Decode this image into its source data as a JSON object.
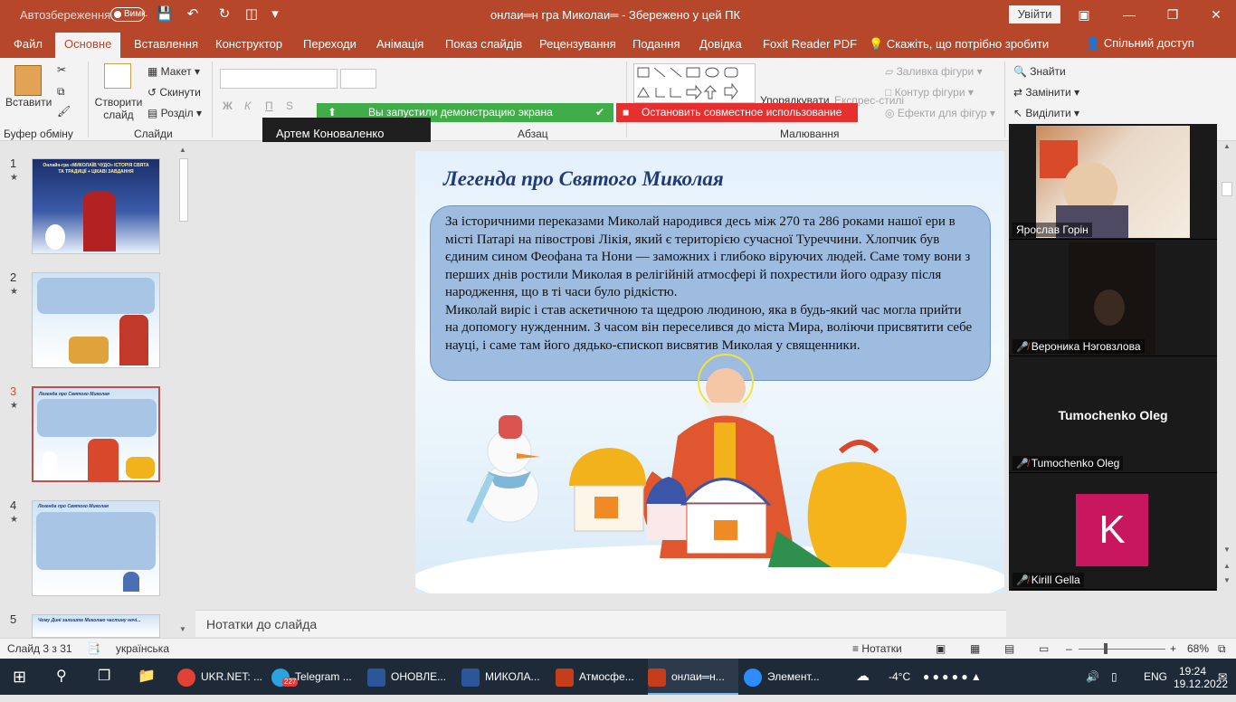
{
  "titlebar": {
    "autosave_label": "Автозбереження",
    "autosave_state": "Вимк.",
    "doc_title": "онлаи═н гра Миколаи═  -  Збережено у цей ПК",
    "sign_in": "Увійти"
  },
  "tabs": [
    "Файл",
    "Основне",
    "Вставлення",
    "Конструктор",
    "Переходи",
    "Анімація",
    "Показ слайдів",
    "Рецензування",
    "Подання",
    "Довідка",
    "Foxit Reader PDF",
    "Скажіть, що потрібно зробити"
  ],
  "share_label": "Спільний доступ",
  "ribbon": {
    "paste": "Вставити",
    "clipboard_group": "Буфер обміну",
    "new_slide": "Створити слайд",
    "layout": "Макет",
    "reset": "Скинути",
    "section": "Розділ",
    "slides_group": "Слайди",
    "paragraph_group": "Абзац",
    "drawing_group": "Малювання",
    "arrange": "Упорядкувати",
    "quick_styles": "Експрес-стилі",
    "shape_fill": "Заливка фігури",
    "shape_outline": "Контур фігури",
    "shape_effects": "Ефекти для фігур",
    "find": "Знайти",
    "replace": "Замінити",
    "select": "Виділити"
  },
  "share_bar": {
    "status": "Вы запустили демонстрацию экрана",
    "stop": "Остановить совместное использование"
  },
  "raise_hand": "Артем Коноваленко підняв руку",
  "thumbnails": [
    {
      "num": "1",
      "caption": "Онлайн-гра «МИКОЛАЇВ ЧУДО» ІСТОРІЯ СВЯТА ТА ТРАДИЦІЇ + ЦІКАВІ ЗАВДАННЯ"
    },
    {
      "num": "2",
      "caption": ""
    },
    {
      "num": "3",
      "caption": "Легенда про Святого Миколая"
    },
    {
      "num": "4",
      "caption": "Легенда про Святого Миколая"
    },
    {
      "num": "5",
      "caption": "Чому Дині залиште Миколаю частину ночі..."
    }
  ],
  "slide": {
    "title": "Легенда про Святого Миколая",
    "paragraph1": "За історичними переказами Миколай народився десь між 270 та 286 роками нашої ери в місті Патарі на півострові Лікія, який є територією сучасної Туреччини. Хлопчик був єдиним сином Феофана та Нони — заможних і глибоко віруючих людей. Саме тому вони з перших днів ростили Миколая в релігійній атмосфері й похрестили його одразу після народження, що в ті часи було рідкістю.",
    "paragraph2": "Миколай виріс і став аскетичною та щедрою людиною, яка в будь-який час могла прийти на допомогу нужденним. З часом він переселився до міста Мира, воліючи присвятити себе науці, і саме там його дядько-єпископ висвятив Миколая у священники."
  },
  "notes_placeholder": "Нотатки до слайда",
  "participants": [
    {
      "name": "Ярослав Горін",
      "muted": false
    },
    {
      "name": "Вероника Нэговзлова",
      "muted": true
    },
    {
      "name": "Tumochenko Oleg",
      "muted": true
    },
    {
      "name": "Kirill Gella",
      "muted": true,
      "initial": "K"
    }
  ],
  "statusbar": {
    "slide_pos": "Слайд 3 з 31",
    "language": "українська",
    "notes": "Нотатки",
    "zoom": "68%"
  },
  "taskbar": {
    "items": [
      "UKR.NET: ...",
      "Telegram ...",
      "ОНОВЛЕ...",
      "МИКОЛА...",
      "Атмосфе...",
      "онлаи═н...",
      "Элемент..."
    ],
    "telegram_badge": "227",
    "weather": "-4°C",
    "lang": "ENG",
    "time": "19:24",
    "date": "19.12.2022"
  },
  "colors": {
    "accent": "#b7472a",
    "share_green": "#3fae49",
    "share_red": "#e5302f"
  }
}
